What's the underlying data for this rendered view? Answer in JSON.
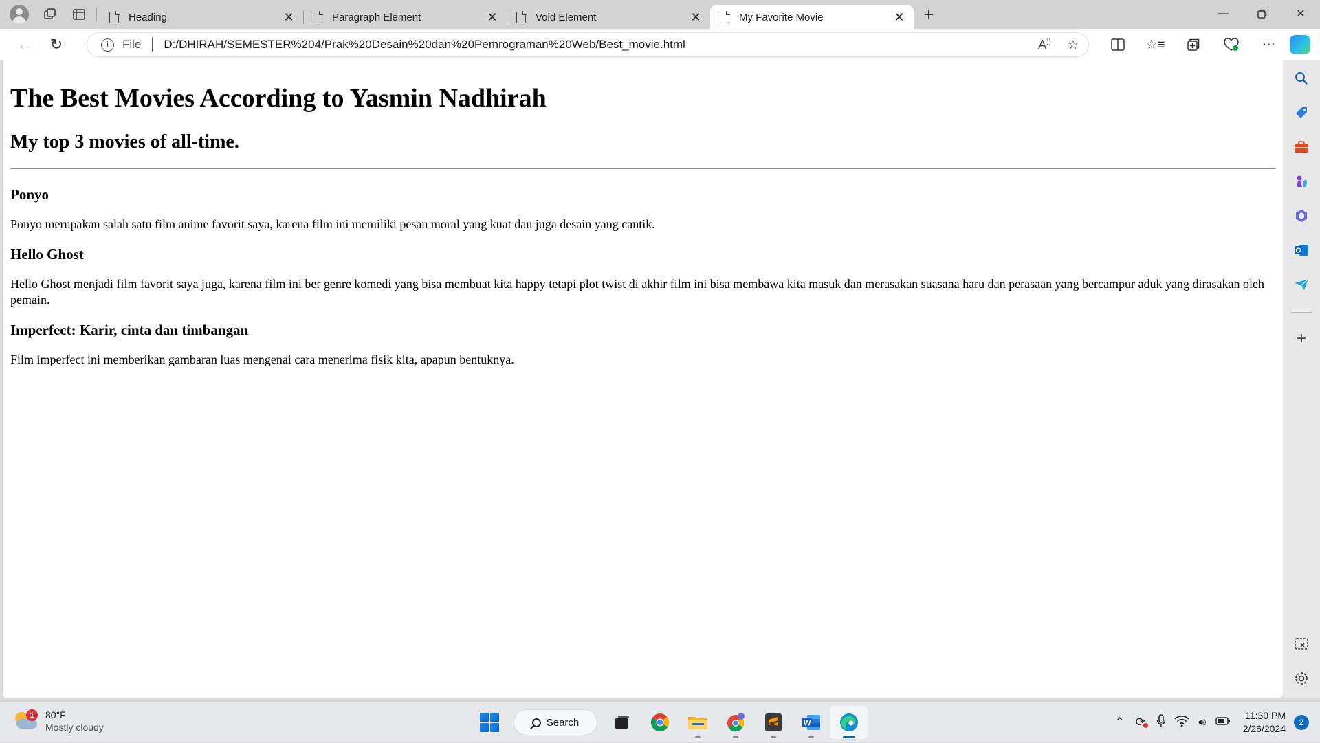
{
  "browser": {
    "tabs": [
      {
        "title": "Heading",
        "active": false
      },
      {
        "title": "Paragraph Element",
        "active": false
      },
      {
        "title": "Void Element",
        "active": false
      },
      {
        "title": "My Favorite Movie",
        "active": true
      }
    ],
    "address": {
      "scheme_label": "File",
      "url": "D:/DHIRAH/SEMESTER%204/Prak%20Desain%20dan%20Pemrograman%20Web/Best_movie.html"
    }
  },
  "page": {
    "h1": "The Best Movies According to Yasmin Nadhirah",
    "h2": "My top 3 movies of all-time.",
    "movies": [
      {
        "title": "Ponyo",
        "desc": "Ponyo merupakan salah satu film anime favorit saya, karena film ini memiliki pesan moral yang kuat dan juga desain yang cantik."
      },
      {
        "title": "Hello Ghost",
        "desc": "Hello Ghost menjadi film favorit saya juga, karena film ini ber genre komedi yang bisa membuat kita happy tetapi plot twist di akhir film ini bisa membawa kita masuk dan merasakan suasana haru dan perasaan yang bercampur aduk yang dirasakan oleh pemain."
      },
      {
        "title": "Imperfect: Karir, cinta dan timbangan",
        "desc": "Film imperfect ini memberikan gambaran luas mengenai cara menerima fisik kita, apapun bentuknya."
      }
    ]
  },
  "taskbar": {
    "weather": {
      "temp": "80°F",
      "condition": "Mostly cloudy",
      "badge": "1"
    },
    "search_label": "Search",
    "clock": {
      "time": "11:30 PM",
      "date": "2/26/2024"
    },
    "notifications": "2"
  },
  "colors": {
    "accent": "#0067c0",
    "tabstrip": "#d3d3d3",
    "sidebar": "#e8e8e8",
    "taskbar": "#e6e8ec"
  }
}
